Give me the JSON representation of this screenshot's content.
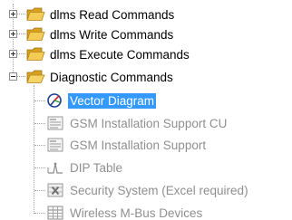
{
  "tree": {
    "folders": [
      {
        "label": "dlms Read Commands",
        "icon": "folder-icon",
        "state": "collapsed"
      },
      {
        "label": "dlms Write Commands",
        "icon": "folder-icon",
        "state": "collapsed"
      },
      {
        "label": "dlms Execute Commands",
        "icon": "folder-icon",
        "state": "collapsed"
      },
      {
        "label": "Diagnostic Commands",
        "icon": "folder-open-icon",
        "state": "expanded"
      }
    ],
    "diagnostic_items": [
      {
        "label": "Vector Diagram",
        "icon": "vector-diagram-icon",
        "selected": true,
        "enabled": true
      },
      {
        "label": "GSM Installation Support CU",
        "icon": "document-lines-icon",
        "selected": false,
        "enabled": false
      },
      {
        "label": "GSM Installation Support",
        "icon": "document-lines-icon",
        "selected": false,
        "enabled": false
      },
      {
        "label": "DIP Table",
        "icon": "dip-table-icon",
        "selected": false,
        "enabled": false
      },
      {
        "label": "Security System (Excel required)",
        "icon": "excel-icon",
        "selected": false,
        "enabled": false
      },
      {
        "label": "Wireless M-Bus Devices",
        "icon": "grid-table-icon",
        "selected": false,
        "enabled": false
      }
    ]
  },
  "colors": {
    "selection": "#3399ff",
    "folder": "#e9b93b",
    "disabled_text": "#8f8f8f"
  }
}
